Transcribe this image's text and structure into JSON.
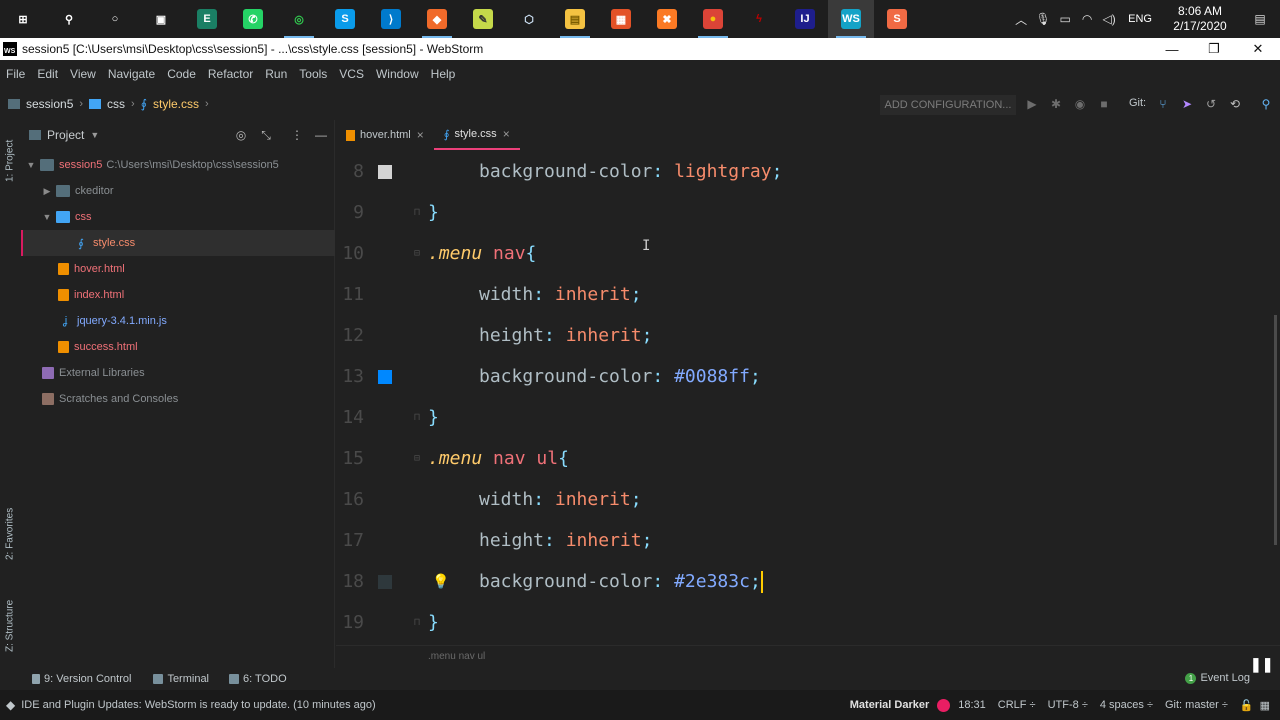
{
  "taskbar": {
    "apps": [
      {
        "name": "windows-start-icon",
        "glyph": "⊞",
        "color": "transparent",
        "fg": "#ffffff"
      },
      {
        "name": "search-icon",
        "glyph": "⚲",
        "color": "transparent",
        "fg": "#ffffff"
      },
      {
        "name": "cortana-icon",
        "glyph": "○",
        "color": "transparent",
        "fg": "#ffffff"
      },
      {
        "name": "task-view-icon",
        "glyph": "▣",
        "color": "transparent",
        "fg": "#ffffff"
      },
      {
        "name": "editor-app-icon",
        "glyph": "E",
        "color": "#1a7f64",
        "fg": "#ffffff"
      },
      {
        "name": "whatsapp-icon",
        "glyph": "✆",
        "color": "#25d366",
        "fg": "#ffffff"
      },
      {
        "name": "green-ring-app-icon",
        "glyph": "◎",
        "color": "transparent",
        "fg": "#31c94f"
      },
      {
        "name": "skype-icon",
        "glyph": "S",
        "color": "#0a9bea",
        "fg": "#ffffff"
      },
      {
        "name": "vscode-icon",
        "glyph": "⟩",
        "color": "#007acc",
        "fg": "#ffffff"
      },
      {
        "name": "brave-browser-icon",
        "glyph": "◆",
        "color": "#f06a2a",
        "fg": "#ffffff"
      },
      {
        "name": "notes-app-icon",
        "glyph": "✎",
        "color": "#c5d94a",
        "fg": "#333333"
      },
      {
        "name": "3d-viewer-icon",
        "glyph": "⬡",
        "color": "transparent",
        "fg": "#cfe3f7"
      },
      {
        "name": "file-explorer-icon",
        "glyph": "▤",
        "color": "#f4c242",
        "fg": "#7a5c00"
      },
      {
        "name": "microsoft-store-icon",
        "glyph": "▦",
        "color": "#e35227",
        "fg": "#ffffff"
      },
      {
        "name": "xampp-icon",
        "glyph": "✖",
        "color": "#fb7a24",
        "fg": "#ffffff"
      },
      {
        "name": "chrome-icon",
        "glyph": "●",
        "color": "#db4437",
        "fg": "#f4c20d"
      },
      {
        "name": "filezilla-icon",
        "glyph": "ϟ",
        "color": "transparent",
        "fg": "#bf0000"
      },
      {
        "name": "intellij-icon",
        "glyph": "IJ",
        "color": "#1e1e8c",
        "fg": "#ffffff"
      },
      {
        "name": "webstorm-icon",
        "glyph": "WS",
        "color": "#14a3c7",
        "fg": "#ffffff"
      },
      {
        "name": "sublime-icon",
        "glyph": "S",
        "color": "#f06a44",
        "fg": "#ffffff"
      }
    ],
    "lang": "ENG",
    "time": "8:06 AM",
    "date": "2/17/2020"
  },
  "window": {
    "title": "session5 [C:\\Users\\msi\\Desktop\\css\\session5] - ...\\css\\style.css [session5] - WebStorm",
    "logo": "WS"
  },
  "menu": [
    "File",
    "Edit",
    "View",
    "Navigate",
    "Code",
    "Refactor",
    "Run",
    "Tools",
    "VCS",
    "Window",
    "Help"
  ],
  "nav": {
    "crumbs": [
      "session5",
      "css",
      "style.css"
    ],
    "add_configuration": "ADD CONFIGURATION...",
    "git_label": "Git:"
  },
  "left_strip": {
    "project_tab": "1: Project",
    "favorites_tab": "2: Favorites",
    "structure_tab": "Z: Structure"
  },
  "project": {
    "header": "Project",
    "root_name": "session5",
    "root_path": "C:\\Users\\msi\\Desktop\\css\\session5",
    "items": [
      "ckeditor",
      "css",
      "style.css",
      "hover.html",
      "index.html",
      "jquery-3.4.1.min.js",
      "success.html"
    ],
    "external_libraries": "External Libraries",
    "scratches": "Scratches and Consoles"
  },
  "tabs": [
    {
      "label": "hover.html",
      "active": false
    },
    {
      "label": "style.css",
      "active": true
    }
  ],
  "editor": {
    "lines": [
      {
        "num": "8",
        "prop": "background-color",
        "value": "lightgray",
        "value_kind": "keyword",
        "swatch": "#d3d3d3"
      },
      {
        "num": "9",
        "close": "}"
      },
      {
        "num": "10",
        "selector_class": ".menu",
        "selector_rest": " nav",
        "open": "{"
      },
      {
        "num": "11",
        "prop": "width",
        "value": "inherit",
        "value_kind": "keyword"
      },
      {
        "num": "12",
        "prop": "height",
        "value": "inherit",
        "value_kind": "keyword"
      },
      {
        "num": "13",
        "prop": "background-color",
        "value": "#0088ff",
        "value_kind": "hex",
        "swatch": "#0088ff"
      },
      {
        "num": "14",
        "close": "}"
      },
      {
        "num": "15",
        "selector_class": ".menu",
        "selector_rest": " nav ul",
        "open": "{"
      },
      {
        "num": "16",
        "prop": "width",
        "value": "inherit",
        "value_kind": "keyword"
      },
      {
        "num": "17",
        "prop": "height",
        "value": "inherit",
        "value_kind": "keyword"
      },
      {
        "num": "18",
        "prop": "background-color",
        "value": "#2e383c",
        "value_kind": "hex",
        "swatch": "#2e383c",
        "caret": true,
        "bulb": true
      },
      {
        "num": "19",
        "close": "}"
      }
    ],
    "breadcrumb": ".menu nav ul"
  },
  "bottom_tools": {
    "version_control": "9: Version Control",
    "terminal": "Terminal",
    "todo": "6: TODO",
    "event_log": "Event Log"
  },
  "status": {
    "message": "IDE and Plugin Updates: WebStorm is ready to update. (10 minutes ago)",
    "theme": "Material Darker",
    "theme_color": "#e91e63",
    "position": "18:31",
    "line_sep": "CRLF ÷",
    "encoding": "UTF-8 ÷",
    "indent": "4 spaces ÷",
    "git": "Git: master ÷"
  }
}
